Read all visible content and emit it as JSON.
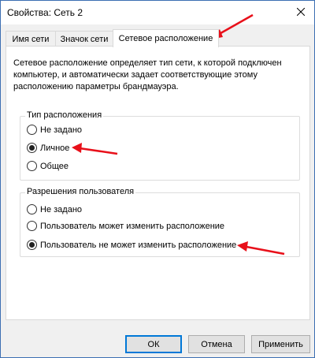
{
  "window": {
    "title": "Свойства: Сеть 2"
  },
  "tabs": [
    {
      "label": "Имя сети",
      "active": false
    },
    {
      "label": "Значок сети",
      "active": false
    },
    {
      "label": "Сетевое расположение",
      "active": true
    }
  ],
  "description": "Сетевое расположение определяет тип сети, к которой подключен компьютер, и автоматически задает соответствующие этому расположению параметры брандмауэра.",
  "location_group": {
    "title": "Тип расположения",
    "options": [
      {
        "label": "Не задано",
        "selected": false
      },
      {
        "label": "Личное",
        "selected": true
      },
      {
        "label": "Общее",
        "selected": false
      }
    ]
  },
  "permissions_group": {
    "title": "Разрешения пользователя",
    "options": [
      {
        "label": "Не задано",
        "selected": false
      },
      {
        "label": "Пользователь может изменить расположение",
        "selected": false
      },
      {
        "label": "Пользователь не может изменить расположение",
        "selected": true
      }
    ]
  },
  "buttons": {
    "ok": "ОК",
    "cancel": "Отмена",
    "apply": "Применить"
  },
  "colors": {
    "annotation_arrow": "#e8101a",
    "window_border": "#3c6fb3",
    "focus": "#0078d7"
  }
}
